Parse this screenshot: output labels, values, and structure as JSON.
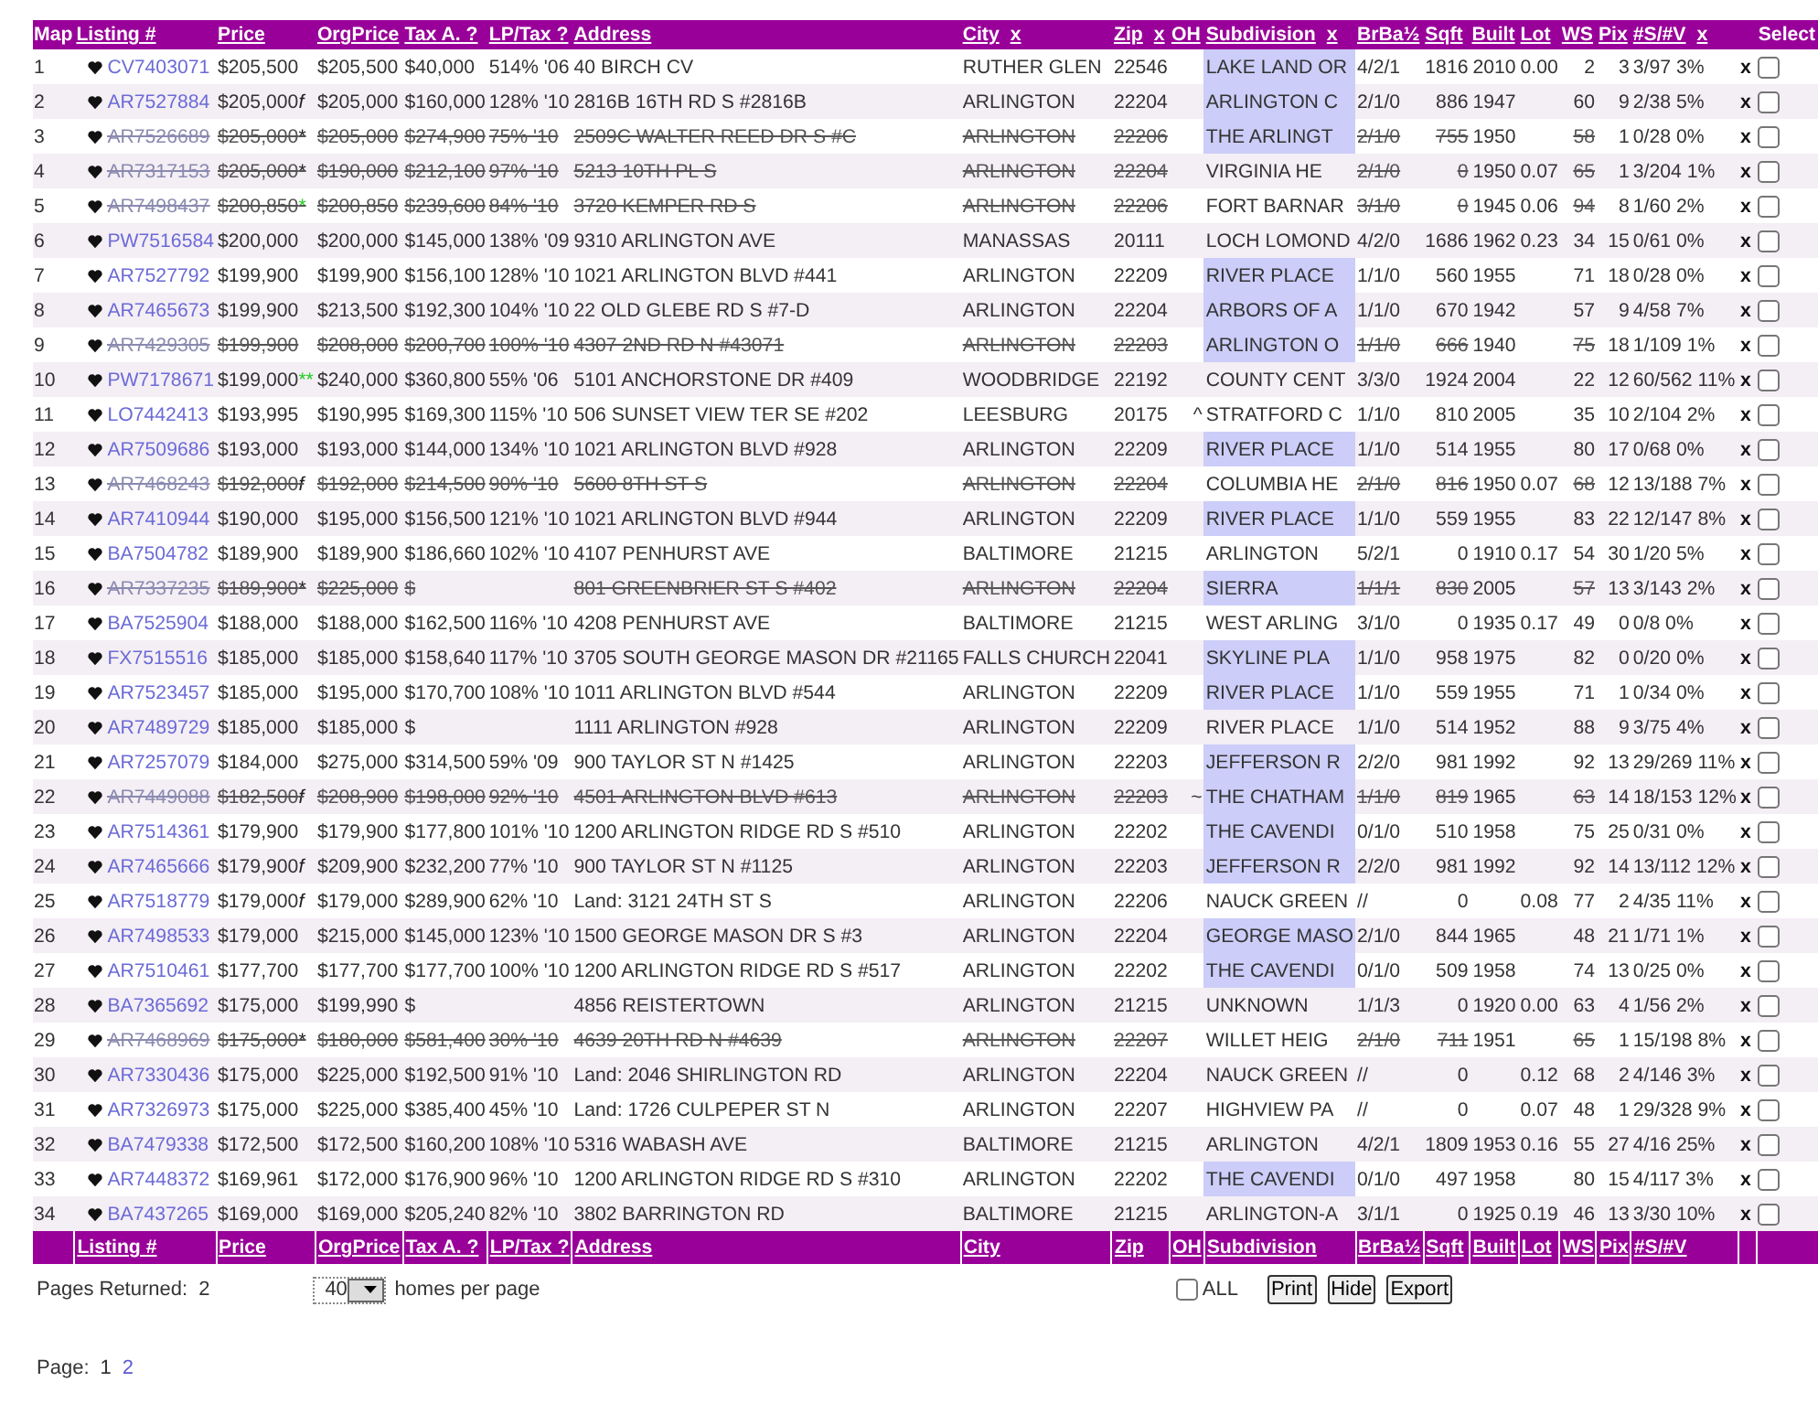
{
  "header": [
    {
      "label": "Map",
      "link": false
    },
    {
      "label": "Listing #",
      "link": true
    },
    {
      "label": "Price",
      "link": true
    },
    {
      "label": "OrgPrice",
      "link": true
    },
    {
      "label": "Tax A. ?",
      "link": true
    },
    {
      "label": "LP/Tax ?",
      "link": true
    },
    {
      "label": "Address",
      "link": true
    },
    {
      "label": "City",
      "link": true,
      "remove": "x"
    },
    {
      "label": "Zip",
      "link": true,
      "remove": "x"
    },
    {
      "label": "OH",
      "link": true
    },
    {
      "label": "Subdivision",
      "link": true,
      "remove": "x"
    },
    {
      "label": "BrBa½",
      "link": true
    },
    {
      "label": "Sqft",
      "link": true
    },
    {
      "label": "Built",
      "link": true
    },
    {
      "label": "Lot",
      "link": true
    },
    {
      "label": "WS",
      "link": true
    },
    {
      "label": "Pix",
      "link": true
    },
    {
      "label": "#S/#V",
      "link": true,
      "remove": "x"
    },
    {
      "label": "Select",
      "link": false
    }
  ],
  "rows": [
    {
      "no": "1",
      "listing": "CV7403071",
      "price": "$205,500",
      "orig": "$205,500",
      "tax": "$40,000",
      "lp_tax": "514% '06",
      "address": "40 BIRCH CV",
      "city": "RUTHER GLEN",
      "zip": "22546",
      "subdivision": "LAKE LAND OR",
      "highlighted": true,
      "br_ba": "4/2/1",
      "sqft": "1816",
      "built": "2010",
      "lot": "0.00",
      "ws": "2",
      "pix": "3",
      "s_v": "3/97 3%",
      "remove": "x",
      "selected": false,
      "struck": false
    },
    {
      "no": "2",
      "listing": "AR7527884",
      "price": "$205,000",
      "flag": {
        "text": "f",
        "color": "#222222"
      },
      "orig": "$205,000",
      "tax": "$160,000",
      "lp_tax": "128% '10",
      "address": "2816B 16TH RD S #2816B",
      "city": "ARLINGTON",
      "zip": "22204",
      "subdivision": "ARLINGTON C",
      "highlighted": true,
      "br_ba": "2/1/0",
      "sqft": "886",
      "built": "1947",
      "ws": "60",
      "pix": "9",
      "s_v": "2/38 5%",
      "remove": "x",
      "selected": false,
      "struck": false
    },
    {
      "no": "3",
      "listing": "AR7526689",
      "price": "$205,000",
      "flag": {
        "text": "*",
        "color": "#222222"
      },
      "orig": "$205,000",
      "tax": "$274,900",
      "lp_tax": "75% '10",
      "address": "2509C WALTER REED DR S #C",
      "city": "ARLINGTON",
      "zip": "22206",
      "subdivision": "THE ARLINGT",
      "highlighted": true,
      "br_ba": "2/1/0",
      "sqft": "755",
      "built": "1950",
      "ws": "58",
      "pix": "1",
      "s_v": "0/28 0%",
      "remove": "x",
      "selected": false,
      "struck": true
    },
    {
      "no": "4",
      "listing": "AR7317153",
      "price": "$205,000",
      "flag": {
        "text": "*",
        "color": "#222222"
      },
      "orig": "$190,000",
      "tax": "$212,100",
      "lp_tax": "97% '10",
      "address": "5213 10TH PL S",
      "city": "ARLINGTON",
      "zip": "22204",
      "subdivision": "VIRGINIA HE",
      "highlighted": false,
      "br_ba": "2/1/0",
      "sqft": "0",
      "built": "1950",
      "lot": "0.07",
      "ws": "65",
      "pix": "1",
      "s_v": "3/204 1%",
      "remove": "x",
      "selected": false,
      "struck": true
    },
    {
      "no": "5",
      "listing": "AR7498437",
      "price": "$200,850",
      "flag": {
        "text": "*",
        "color": "#22cc22"
      },
      "orig": "$200,850",
      "tax": "$239,600",
      "lp_tax": "84% '10",
      "address": "3720 KEMPER RD S",
      "city": "ARLINGTON",
      "zip": "22206",
      "subdivision": "FORT BARNAR",
      "highlighted": false,
      "br_ba": "3/1/0",
      "sqft": "0",
      "built": "1945",
      "lot": "0.06",
      "ws": "94",
      "pix": "8",
      "s_v": "1/60 2%",
      "remove": "x",
      "selected": false,
      "struck": true
    },
    {
      "no": "6",
      "listing": "PW7516584",
      "price": "$200,000",
      "orig": "$200,000",
      "tax": "$145,000",
      "lp_tax": "138% '09",
      "address": "9310 ARLINGTON AVE",
      "city": "MANASSAS",
      "zip": "20111",
      "subdivision": "LOCH LOMOND",
      "highlighted": false,
      "br_ba": "4/2/0",
      "sqft": "1686",
      "built": "1962",
      "lot": "0.23",
      "ws": "34",
      "pix": "15",
      "s_v": "0/61 0%",
      "remove": "x",
      "selected": false,
      "struck": false
    },
    {
      "no": "7",
      "listing": "AR7527792",
      "price": "$199,900",
      "orig": "$199,900",
      "tax": "$156,100",
      "lp_tax": "128% '10",
      "address": "1021 ARLINGTON BLVD #441",
      "city": "ARLINGTON",
      "zip": "22209",
      "subdivision": "RIVER PLACE",
      "highlighted": true,
      "br_ba": "1/1/0",
      "sqft": "560",
      "built": "1955",
      "ws": "71",
      "pix": "18",
      "s_v": "0/28 0%",
      "remove": "x",
      "selected": false,
      "struck": false
    },
    {
      "no": "8",
      "listing": "AR7465673",
      "price": "$199,900",
      "orig": "$213,500",
      "tax": "$192,300",
      "lp_tax": "104% '10",
      "address": "22 OLD GLEBE RD S #7-D",
      "city": "ARLINGTON",
      "zip": "22204",
      "subdivision": "ARBORS OF A",
      "highlighted": true,
      "br_ba": "1/1/0",
      "sqft": "670",
      "built": "1942",
      "ws": "57",
      "pix": "9",
      "s_v": "4/58 7%",
      "remove": "x",
      "selected": false,
      "struck": false
    },
    {
      "no": "9",
      "listing": "AR7429305",
      "price": "$199,900",
      "orig": "$208,000",
      "tax": "$200,700",
      "lp_tax": "100% '10",
      "address": "4307 2ND RD N #43071",
      "city": "ARLINGTON",
      "zip": "22203",
      "subdivision": "ARLINGTON O",
      "highlighted": true,
      "br_ba": "1/1/0",
      "sqft": "666",
      "built": "1940",
      "ws": "75",
      "pix": "18",
      "s_v": "1/109 1%",
      "remove": "x",
      "selected": false,
      "struck": true
    },
    {
      "no": "10",
      "listing": "PW7178671",
      "price": "$199,000",
      "flag": {
        "text": "**",
        "color": "#22cc22"
      },
      "orig": "$240,000",
      "tax": "$360,800",
      "lp_tax": "55% '06",
      "address": "5101 ANCHORSTONE DR #409",
      "city": "WOODBRIDGE",
      "zip": "22192",
      "subdivision": "COUNTY CENT",
      "highlighted": false,
      "br_ba": "3/3/0",
      "sqft": "1924",
      "built": "2004",
      "ws": "22",
      "pix": "12",
      "s_v": "60/562 11%",
      "remove": "x",
      "selected": false,
      "struck": false
    },
    {
      "no": "11",
      "listing": "LO7442413",
      "price": "$193,995",
      "orig": "$190,995",
      "tax": "$169,300",
      "lp_tax": "115% '10",
      "address": "506 SUNSET VIEW TER SE #202",
      "city": "LEESBURG",
      "zip": "20175",
      "oh": "^",
      "subdivision": "STRATFORD C",
      "highlighted": false,
      "br_ba": "1/1/0",
      "sqft": "810",
      "built": "2005",
      "ws": "35",
      "pix": "10",
      "s_v": "2/104 2%",
      "remove": "x",
      "selected": false,
      "struck": false
    },
    {
      "no": "12",
      "listing": "AR7509686",
      "price": "$193,000",
      "orig": "$193,000",
      "tax": "$144,000",
      "lp_tax": "134% '10",
      "address": "1021 ARLINGTON BLVD #928",
      "city": "ARLINGTON",
      "zip": "22209",
      "subdivision": "RIVER PLACE",
      "highlighted": true,
      "br_ba": "1/1/0",
      "sqft": "514",
      "built": "1955",
      "ws": "80",
      "pix": "17",
      "s_v": "0/68 0%",
      "remove": "x",
      "selected": false,
      "struck": false
    },
    {
      "no": "13",
      "listing": "AR7468243",
      "price": "$192,000",
      "flag": {
        "text": "f",
        "color": "#222222"
      },
      "orig": "$192,000",
      "tax": "$214,500",
      "lp_tax": "90% '10",
      "address": "5600 8TH ST S",
      "city": "ARLINGTON",
      "zip": "22204",
      "subdivision": "COLUMBIA HE",
      "highlighted": false,
      "br_ba": "2/1/0",
      "sqft": "816",
      "built": "1950",
      "lot": "0.07",
      "ws": "68",
      "pix": "12",
      "s_v": "13/188 7%",
      "remove": "x",
      "selected": false,
      "struck": true
    },
    {
      "no": "14",
      "listing": "AR7410944",
      "price": "$190,000",
      "orig": "$195,000",
      "tax": "$156,500",
      "lp_tax": "121% '10",
      "address": "1021 ARLINGTON BLVD #944",
      "city": "ARLINGTON",
      "zip": "22209",
      "subdivision": "RIVER PLACE",
      "highlighted": true,
      "br_ba": "1/1/0",
      "sqft": "559",
      "built": "1955",
      "ws": "83",
      "pix": "22",
      "s_v": "12/147 8%",
      "remove": "x",
      "selected": false,
      "struck": false
    },
    {
      "no": "15",
      "listing": "BA7504782",
      "price": "$189,900",
      "orig": "$189,900",
      "tax": "$186,660",
      "lp_tax": "102% '10",
      "address": "4107 PENHURST AVE",
      "city": "BALTIMORE",
      "zip": "21215",
      "subdivision": "ARLINGTON",
      "highlighted": false,
      "br_ba": "5/2/1",
      "sqft": "0",
      "built": "1910",
      "lot": "0.17",
      "ws": "54",
      "pix": "30",
      "s_v": "1/20 5%",
      "remove": "x",
      "selected": false,
      "struck": false
    },
    {
      "no": "16",
      "listing": "AR7337235",
      "price": "$189,900",
      "flag": {
        "text": "*",
        "color": "#222222"
      },
      "orig": "$225,000",
      "tax": "$",
      "address": "801 GREENBRIER ST S #402",
      "city": "ARLINGTON",
      "zip": "22204",
      "subdivision": "SIERRA",
      "highlighted": true,
      "br_ba": "1/1/1",
      "sqft": "830",
      "built": "2005",
      "ws": "57",
      "pix": "13",
      "s_v": "3/143 2%",
      "remove": "x",
      "selected": false,
      "struck": true
    },
    {
      "no": "17",
      "listing": "BA7525904",
      "price": "$188,000",
      "orig": "$188,000",
      "tax": "$162,500",
      "lp_tax": "116% '10",
      "address": "4208 PENHURST AVE",
      "city": "BALTIMORE",
      "zip": "21215",
      "subdivision": "WEST ARLING",
      "highlighted": false,
      "br_ba": "3/1/0",
      "sqft": "0",
      "built": "1935",
      "lot": "0.17",
      "ws": "49",
      "pix": "0",
      "s_v": "0/8 0%",
      "remove": "x",
      "selected": false,
      "struck": false
    },
    {
      "no": "18",
      "listing": "FX7515516",
      "price": "$185,000",
      "orig": "$185,000",
      "tax": "$158,640",
      "lp_tax": "117% '10",
      "address": "3705 SOUTH GEORGE MASON DR #21165",
      "city": "FALLS CHURCH",
      "zip": "22041",
      "subdivision": "SKYLINE PLA",
      "highlighted": true,
      "br_ba": "1/1/0",
      "sqft": "958",
      "built": "1975",
      "ws": "82",
      "pix": "0",
      "s_v": "0/20 0%",
      "remove": "x",
      "selected": false,
      "struck": false
    },
    {
      "no": "19",
      "listing": "AR7523457",
      "price": "$185,000",
      "orig": "$195,000",
      "tax": "$170,700",
      "lp_tax": "108% '10",
      "address": "1011 ARLINGTON BLVD #544",
      "city": "ARLINGTON",
      "zip": "22209",
      "subdivision": "RIVER PLACE",
      "highlighted": true,
      "br_ba": "1/1/0",
      "sqft": "559",
      "built": "1955",
      "ws": "71",
      "pix": "1",
      "s_v": "0/34 0%",
      "remove": "x",
      "selected": false,
      "struck": false
    },
    {
      "no": "20",
      "listing": "AR7489729",
      "price": "$185,000",
      "orig": "$185,000",
      "tax": "$",
      "address": "1111 ARLINGTON #928",
      "city": "ARLINGTON",
      "zip": "22209",
      "subdivision": "RIVER PLACE",
      "highlighted": false,
      "br_ba": "1/1/0",
      "sqft": "514",
      "built": "1952",
      "ws": "88",
      "pix": "9",
      "s_v": "3/75 4%",
      "remove": "x",
      "selected": false,
      "struck": false
    },
    {
      "no": "21",
      "listing": "AR7257079",
      "price": "$184,000",
      "orig": "$275,000",
      "tax": "$314,500",
      "lp_tax": "59% '09",
      "address": "900 TAYLOR ST N #1425",
      "city": "ARLINGTON",
      "zip": "22203",
      "subdivision": "JEFFERSON R",
      "highlighted": true,
      "br_ba": "2/2/0",
      "sqft": "981",
      "built": "1992",
      "ws": "92",
      "pix": "13",
      "s_v": "29/269 11%",
      "remove": "x",
      "selected": false,
      "struck": false
    },
    {
      "no": "22",
      "listing": "AR7449088",
      "price": "$182,500",
      "flag": {
        "text": "f",
        "color": "#222222"
      },
      "orig": "$208,900",
      "tax": "$198,000",
      "lp_tax": "92% '10",
      "address": "4501 ARLINGTON BLVD #613",
      "city": "ARLINGTON",
      "zip": "22203",
      "oh": "~",
      "subdivision": "THE CHATHAM",
      "highlighted": true,
      "br_ba": "1/1/0",
      "sqft": "819",
      "built": "1965",
      "ws": "63",
      "pix": "14",
      "s_v": "18/153 12%",
      "remove": "x",
      "selected": false,
      "struck": true
    },
    {
      "no": "23",
      "listing": "AR7514361",
      "price": "$179,900",
      "orig": "$179,900",
      "tax": "$177,800",
      "lp_tax": "101% '10",
      "address": "1200 ARLINGTON RIDGE RD S #510",
      "city": "ARLINGTON",
      "zip": "22202",
      "subdivision": "THE CAVENDI",
      "highlighted": true,
      "br_ba": "0/1/0",
      "sqft": "510",
      "built": "1958",
      "ws": "75",
      "pix": "25",
      "s_v": "0/31 0%",
      "remove": "x",
      "selected": false,
      "struck": false
    },
    {
      "no": "24",
      "listing": "AR7465666",
      "price": "$179,900",
      "flag": {
        "text": "f",
        "color": "#222222"
      },
      "orig": "$209,900",
      "tax": "$232,200",
      "lp_tax": "77% '10",
      "address": "900 TAYLOR ST N #1125",
      "city": "ARLINGTON",
      "zip": "22203",
      "subdivision": "JEFFERSON R",
      "highlighted": true,
      "br_ba": "2/2/0",
      "sqft": "981",
      "built": "1992",
      "ws": "92",
      "pix": "14",
      "s_v": "13/112 12%",
      "remove": "x",
      "selected": false,
      "struck": false
    },
    {
      "no": "25",
      "listing": "AR7518779",
      "price": "$179,000",
      "flag": {
        "text": "f",
        "color": "#222222"
      },
      "orig": "$179,000",
      "tax": "$289,900",
      "lp_tax": "62% '10",
      "address": "Land: 3121 24TH ST S",
      "city": "ARLINGTON",
      "zip": "22206",
      "subdivision": "NAUCK GREEN",
      "highlighted": false,
      "br_ba": "//",
      "sqft": "0",
      "lot": "0.08",
      "ws": "77",
      "pix": "2",
      "s_v": "4/35 11%",
      "remove": "x",
      "selected": false,
      "struck": false
    },
    {
      "no": "26",
      "listing": "AR7498533",
      "price": "$179,000",
      "orig": "$215,000",
      "tax": "$145,000",
      "lp_tax": "123% '10",
      "address": "1500 GEORGE MASON DR S #3",
      "city": "ARLINGTON",
      "zip": "22204",
      "subdivision": "GEORGE MASO",
      "highlighted": true,
      "br_ba": "2/1/0",
      "sqft": "844",
      "built": "1965",
      "ws": "48",
      "pix": "21",
      "s_v": "1/71 1%",
      "remove": "x",
      "selected": false,
      "struck": false
    },
    {
      "no": "27",
      "listing": "AR7510461",
      "price": "$177,700",
      "orig": "$177,700",
      "tax": "$177,700",
      "lp_tax": "100% '10",
      "address": "1200 ARLINGTON RIDGE RD S #517",
      "city": "ARLINGTON",
      "zip": "22202",
      "subdivision": "THE CAVENDI",
      "highlighted": true,
      "br_ba": "0/1/0",
      "sqft": "509",
      "built": "1958",
      "ws": "74",
      "pix": "13",
      "s_v": "0/25 0%",
      "remove": "x",
      "selected": false,
      "struck": false
    },
    {
      "no": "28",
      "listing": "BA7365692",
      "price": "$175,000",
      "orig": "$199,990",
      "tax": "$",
      "address": "4856 REISTERTOWN",
      "city": "ARLINGTON",
      "zip": "21215",
      "subdivision": "UNKNOWN",
      "highlighted": false,
      "br_ba": "1/1/3",
      "sqft": "0",
      "built": "1920",
      "lot": "0.00",
      "ws": "63",
      "pix": "4",
      "s_v": "1/56 2%",
      "remove": "x",
      "selected": false,
      "struck": false
    },
    {
      "no": "29",
      "listing": "AR7468969",
      "price": "$175,000",
      "flag": {
        "text": "*",
        "color": "#222222"
      },
      "orig": "$180,000",
      "tax": "$581,400",
      "lp_tax": "30% '10",
      "address": "4639 20TH RD N #4639",
      "city": "ARLINGTON",
      "zip": "22207",
      "subdivision": "WILLET HEIG",
      "highlighted": false,
      "br_ba": "2/1/0",
      "sqft": "711",
      "built": "1951",
      "ws": "65",
      "pix": "1",
      "s_v": "15/198 8%",
      "remove": "x",
      "selected": false,
      "struck": true
    },
    {
      "no": "30",
      "listing": "AR7330436",
      "price": "$175,000",
      "orig": "$225,000",
      "tax": "$192,500",
      "lp_tax": "91% '10",
      "address": "Land: 2046 SHIRLINGTON RD",
      "city": "ARLINGTON",
      "zip": "22204",
      "subdivision": "NAUCK GREEN",
      "highlighted": false,
      "br_ba": "//",
      "sqft": "0",
      "lot": "0.12",
      "ws": "68",
      "pix": "2",
      "s_v": "4/146 3%",
      "remove": "x",
      "selected": false,
      "struck": false
    },
    {
      "no": "31",
      "listing": "AR7326973",
      "price": "$175,000",
      "orig": "$225,000",
      "tax": "$385,400",
      "lp_tax": "45% '10",
      "address": "Land: 1726 CULPEPER ST N",
      "city": "ARLINGTON",
      "zip": "22207",
      "subdivision": "HIGHVIEW PA",
      "highlighted": false,
      "br_ba": "//",
      "sqft": "0",
      "lot": "0.07",
      "ws": "48",
      "pix": "1",
      "s_v": "29/328 9%",
      "remove": "x",
      "selected": false,
      "struck": false
    },
    {
      "no": "32",
      "listing": "BA7479338",
      "price": "$172,500",
      "orig": "$172,500",
      "tax": "$160,200",
      "lp_tax": "108% '10",
      "address": "5316 WABASH AVE",
      "city": "BALTIMORE",
      "zip": "21215",
      "subdivision": "ARLINGTON",
      "highlighted": false,
      "br_ba": "4/2/1",
      "sqft": "1809",
      "built": "1953",
      "lot": "0.16",
      "ws": "55",
      "pix": "27",
      "s_v": "4/16 25%",
      "remove": "x",
      "selected": false,
      "struck": false
    },
    {
      "no": "33",
      "listing": "AR7448372",
      "price": "$169,961",
      "orig": "$172,000",
      "tax": "$176,900",
      "lp_tax": "96% '10",
      "address": "1200 ARLINGTON RIDGE RD S #310",
      "city": "ARLINGTON",
      "zip": "22202",
      "subdivision": "THE CAVENDI",
      "highlighted": true,
      "br_ba": "0/1/0",
      "sqft": "497",
      "built": "1958",
      "ws": "80",
      "pix": "15",
      "s_v": "4/117 3%",
      "remove": "x",
      "selected": false,
      "struck": false
    },
    {
      "no": "34",
      "listing": "BA7437265",
      "price": "$169,000",
      "orig": "$169,000",
      "tax": "$205,240",
      "lp_tax": "82% '10",
      "address": "3802 BARRINGTON RD",
      "city": "BALTIMORE",
      "zip": "21215",
      "subdivision": "ARLINGTON-A",
      "highlighted": false,
      "br_ba": "3/1/1",
      "sqft": "0",
      "built": "1925",
      "lot": "0.19",
      "ws": "46",
      "pix": "13",
      "s_v": "3/30 10%",
      "remove": "x",
      "selected": false,
      "struck": false
    }
  ],
  "footer_header": [
    {
      "label": "Listing #"
    },
    {
      "label": "Price"
    },
    {
      "label": "OrgPrice"
    },
    {
      "label": "Tax A. ?"
    },
    {
      "label": "LP/Tax ?"
    },
    {
      "label": "Address"
    },
    {
      "label": "City"
    },
    {
      "label": "Zip"
    },
    {
      "label": "OH"
    },
    {
      "label": "Subdivision"
    },
    {
      "label": "BrBa½"
    },
    {
      "label": "Sqft"
    },
    {
      "label": "Built"
    },
    {
      "label": "Lot"
    },
    {
      "label": "WS"
    },
    {
      "label": "Pix"
    },
    {
      "label": "#S/#V"
    }
  ],
  "controls": {
    "pages_returned_label": "Pages Returned:",
    "pages_returned": "2",
    "per_page": "40",
    "per_page_label": "homes per page",
    "select_all": {
      "label": "ALL",
      "checked": false
    },
    "buttons": [
      "Print",
      "Hide",
      "Export"
    ]
  },
  "pagination": {
    "label": "Page:",
    "pages": [
      {
        "label": "1",
        "selected": true
      },
      {
        "label": "2",
        "selected": false
      }
    ]
  }
}
